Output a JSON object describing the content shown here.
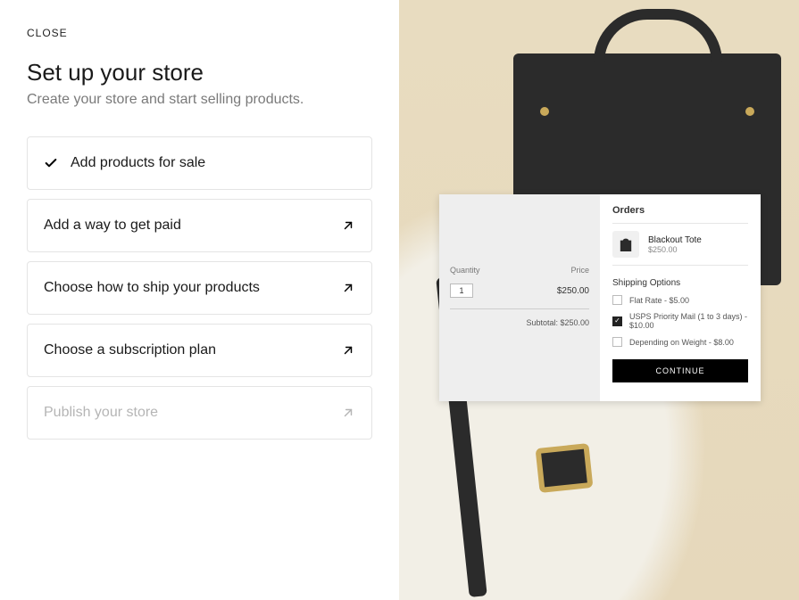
{
  "close_label": "CLOSE",
  "title": "Set up your store",
  "subtitle": "Create your store and start selling products.",
  "steps": [
    {
      "label": "Add products for sale"
    },
    {
      "label": "Add a way to get paid"
    },
    {
      "label": "Choose how to ship your products"
    },
    {
      "label": "Choose a subscription plan"
    },
    {
      "label": "Publish your store"
    }
  ],
  "orders_card": {
    "cart": {
      "quantity_header": "Quantity",
      "price_header": "Price",
      "qty_value": "1",
      "line_price": "$250.00",
      "subtotal_label": "Subtotal: $250.00"
    },
    "orders_title": "Orders",
    "product": {
      "name": "Blackout Tote",
      "price": "$250.00"
    },
    "shipping_title": "Shipping Options",
    "shipping_options": [
      {
        "label": "Flat Rate - $5.00",
        "checked": false
      },
      {
        "label": "USPS Priority Mail (1 to 3 days) - $10.00",
        "checked": true
      },
      {
        "label": "Depending on Weight - $8.00",
        "checked": false
      }
    ],
    "continue_label": "CONTINUE"
  }
}
